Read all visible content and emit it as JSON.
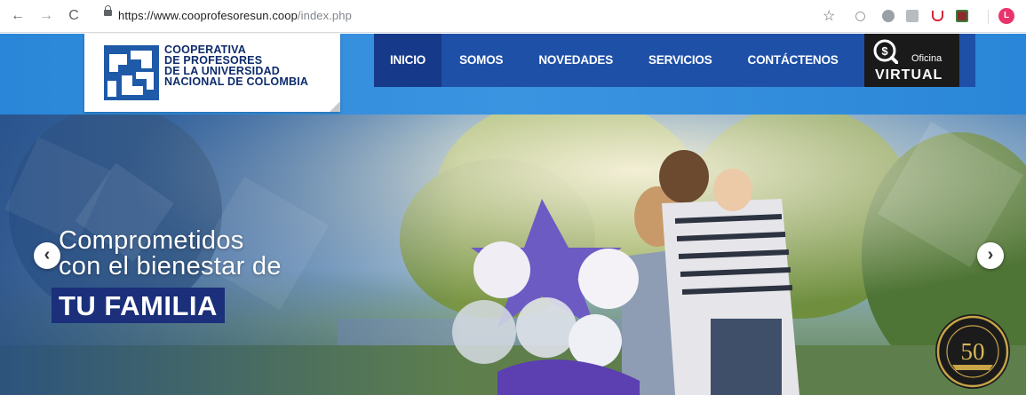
{
  "browser": {
    "url_host": "https://www.cooprofesoresun.coop",
    "url_path": "/index.php",
    "back_icon": "←",
    "forward_icon": "→",
    "reload_icon": "C",
    "star_icon": "☆",
    "profile_initial": "L",
    "extensions": [
      "circle-extension-icon",
      "skype-icon",
      "grammarly-icon",
      "pocket-icon",
      "shield-extension-icon"
    ]
  },
  "logo": {
    "lines": [
      "COOPERATIVA",
      "DE PROFESORES",
      "DE LA UNIVERSIDAD",
      "NACIONAL DE COLOMBIA"
    ]
  },
  "nav": {
    "items": [
      "INICIO",
      "SOMOS",
      "NOVEDADES",
      "SERVICIOS",
      "CONTÁCTENOS"
    ],
    "active": "INICIO"
  },
  "oficina": {
    "small": "Oficina",
    "big": "VIRTUAL"
  },
  "hero": {
    "line1": "Comprometidos",
    "line2": "con el bienestar de",
    "highlight": "TU FAMILIA",
    "prev_icon": "‹",
    "next_icon": "›",
    "seal_number": "50"
  },
  "colors": {
    "header_blue": "#2a86d8",
    "nav_active": "#16398a",
    "logo_navy": "#0d2b6b",
    "highlight_bg": "#1b2f7a",
    "oficina_bg": "#1a1a1a"
  }
}
